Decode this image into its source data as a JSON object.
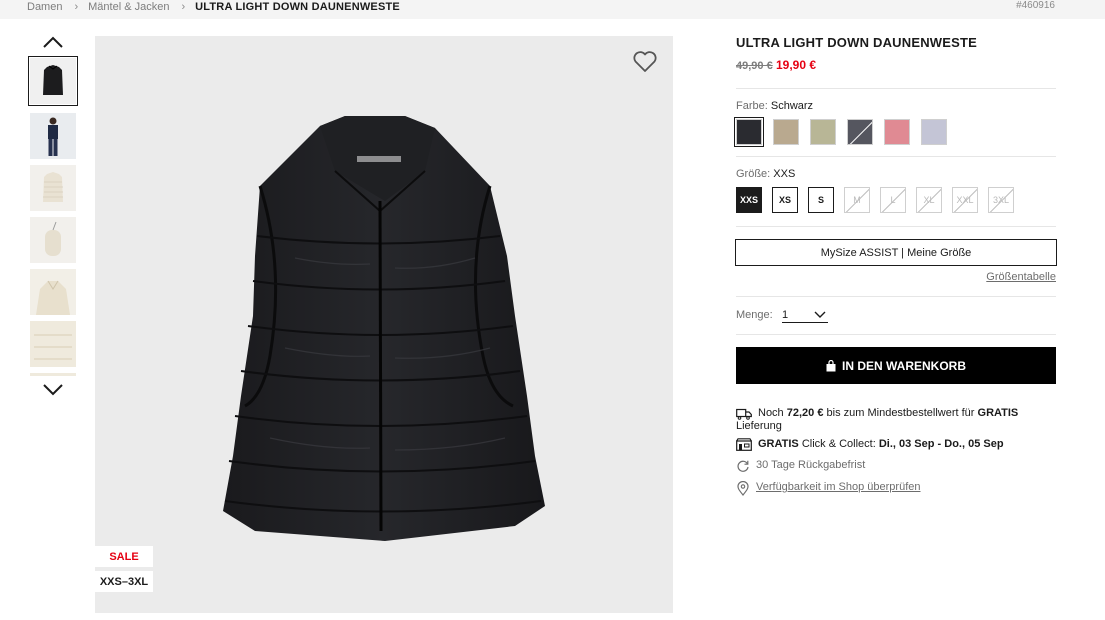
{
  "breadcrumb": {
    "items": [
      "Damen",
      "Mäntel & Jacken"
    ],
    "current": "ULTRA LIGHT DOWN DAUNENWESTE",
    "product_number": "#460916"
  },
  "product": {
    "title": "ULTRA LIGHT DOWN DAUNENWESTE",
    "old_price": "49,90 €",
    "new_price": "19,90 €",
    "sale_flag": "SALE",
    "size_range_flag": "XXS–3XL"
  },
  "color": {
    "label": "Farbe:",
    "selected": "Schwarz",
    "swatches": [
      "#2a2b30",
      "#b9a98f",
      "#b8b696",
      "#55565f",
      "#e08a93",
      "#c4c5d6"
    ]
  },
  "size": {
    "label": "Größe:",
    "selected": "XXS",
    "options": [
      "XXS",
      "XS",
      "S",
      "M",
      "L",
      "XL",
      "XXL",
      "3XL"
    ]
  },
  "mysize_button": "MySize ASSIST | Meine Größe",
  "size_table_link": "Größentabelle",
  "quantity": {
    "label": "Menge:",
    "value": "1"
  },
  "cart_button": "IN DEN WARENKORB",
  "delivery": {
    "line1_pre": "Noch",
    "line1_amount": "72,20 €",
    "line1_mid": "bis zum Mindestbestellwert für",
    "line1_bold": "GRATIS",
    "line1_post": "Lieferung",
    "line2_bold": "GRATIS",
    "line2_text": "Click & Collect:",
    "line2_dates": "Di., 03 Sep - Do., 05 Sep",
    "line3": "30 Tage Rückgabefrist",
    "line4": "Verfügbarkeit im Shop überprüfen"
  },
  "colors": {
    "sale_red": "#e60012",
    "dark": "#1b1b1b",
    "image_bg": "#ebebeb"
  }
}
